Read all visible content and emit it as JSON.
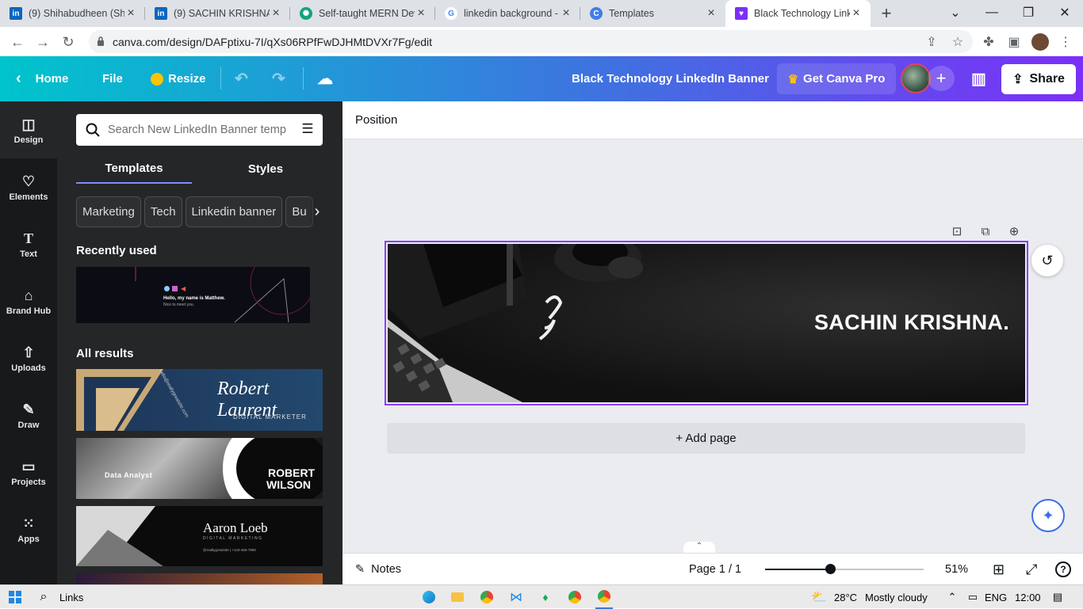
{
  "browser": {
    "tabs": [
      {
        "title": "(9) Shihabudheen (Shi",
        "icon": "linkedin-icon",
        "color": "#0a66c2"
      },
      {
        "title": "(9) SACHIN KRISHNA |",
        "icon": "linkedin-icon",
        "color": "#0a66c2"
      },
      {
        "title": "Self-taught MERN Dev",
        "icon": "chatgpt-icon",
        "color": "#10a37f"
      },
      {
        "title": "linkedin background -",
        "icon": "google-icon",
        "color": "#4285f4"
      },
      {
        "title": "Templates",
        "icon": "canva-icon",
        "color": "#3f7ee8"
      },
      {
        "title": "Black Technology Link",
        "icon": "canva-heart-icon",
        "color": "#7b2ff7"
      }
    ],
    "active_tab": 5,
    "url": "canva.com/design/DAFptixu-7I/qXs06RPfFwDJHMtDVXr7Fg/edit"
  },
  "topbar": {
    "home": "Home",
    "file": "File",
    "resize": "Resize",
    "design_title": "Black Technology LinkedIn Banner",
    "get_pro": "Get Canva Pro",
    "share": "Share"
  },
  "rail": [
    {
      "label": "Design",
      "icon": "design-icon"
    },
    {
      "label": "Elements",
      "icon": "elements-icon"
    },
    {
      "label": "Text",
      "icon": "text-icon"
    },
    {
      "label": "Brand Hub",
      "icon": "brand-hub-icon"
    },
    {
      "label": "Uploads",
      "icon": "uploads-icon"
    },
    {
      "label": "Draw",
      "icon": "draw-icon"
    },
    {
      "label": "Projects",
      "icon": "projects-icon"
    },
    {
      "label": "Apps",
      "icon": "apps-icon"
    }
  ],
  "panel": {
    "search_placeholder": "Search New LinkedIn Banner temp",
    "tabs": [
      "Templates",
      "Styles"
    ],
    "chips": [
      "Marketing",
      "Tech",
      "Linkedin banner",
      "Bu"
    ],
    "recently_used": "Recently used",
    "recent_thumb_text": "Hello, my name is Matthew.",
    "recent_thumb_sub": "Nice to meet you.",
    "all_results": "All results",
    "results": [
      {
        "name": "Robert Laurent",
        "role": "DIGITAL MARKETER",
        "site": "hello@reallygreatsite.com"
      },
      {
        "name1": "ROBERT",
        "name2": "WILSON",
        "role": "Data Analyst"
      },
      {
        "name": "Aaron Loeb",
        "role": "DIGITAL MARKETING",
        "contact": "@reallygreatsite   |   +123-456-7890"
      }
    ]
  },
  "editor": {
    "position": "Position",
    "banner_text": "SACHIN KRISHNA.",
    "add_page": "+ Add page"
  },
  "footer": {
    "notes": "Notes",
    "page": "Page 1 / 1",
    "zoom": "51%",
    "zoom_fraction": 0.41
  },
  "taskbar": {
    "search": "Links",
    "temp": "28°C",
    "weather": "Mostly cloudy",
    "lang": "ENG",
    "time": "12:00"
  }
}
